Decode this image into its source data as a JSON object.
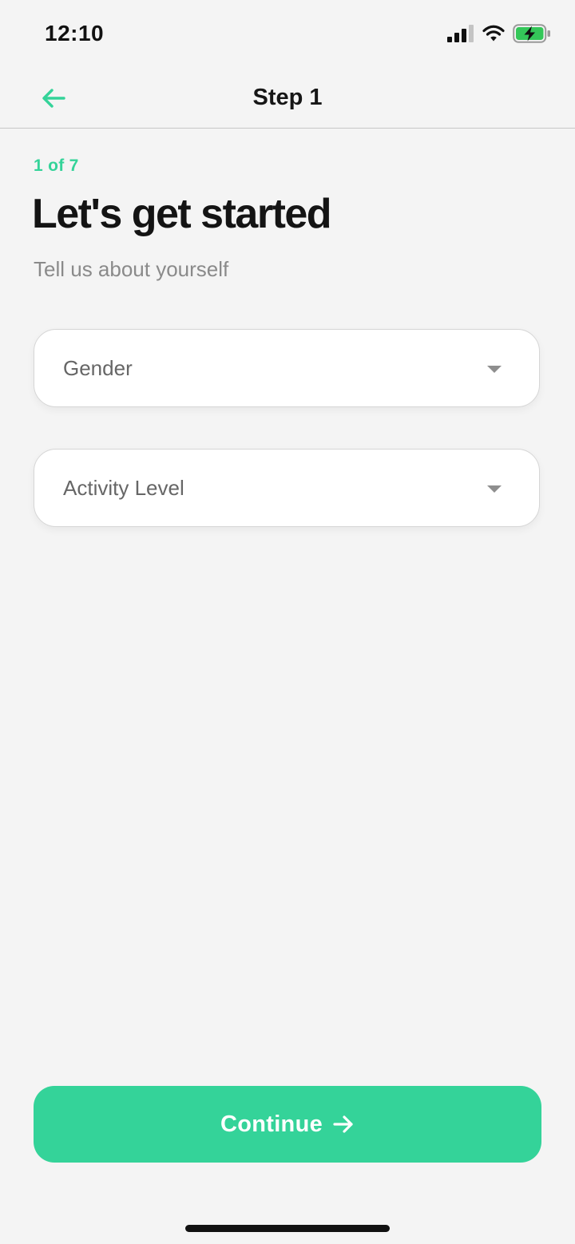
{
  "status_bar": {
    "time": "12:10",
    "icons": [
      "cellular-signal-icon",
      "wifi-icon",
      "battery-charging-icon"
    ]
  },
  "nav": {
    "title": "Step 1",
    "back_icon": "arrow-left-icon"
  },
  "progress": {
    "label": "1 of 7",
    "current": 1,
    "total": 7
  },
  "header": {
    "title": "Let's get started",
    "subtitle": "Tell us about yourself"
  },
  "form": {
    "gender": {
      "placeholder": "Gender",
      "icon": "chevron-down-icon"
    },
    "activity": {
      "placeholder": "Activity Level",
      "icon": "chevron-down-icon"
    }
  },
  "footer": {
    "continue_label": "Continue",
    "continue_icon": "arrow-right-icon"
  },
  "colors": {
    "accent": "#34d399",
    "background": "#f4f4f4",
    "field_background": "#ffffff",
    "battery_fill": "#34c759"
  }
}
